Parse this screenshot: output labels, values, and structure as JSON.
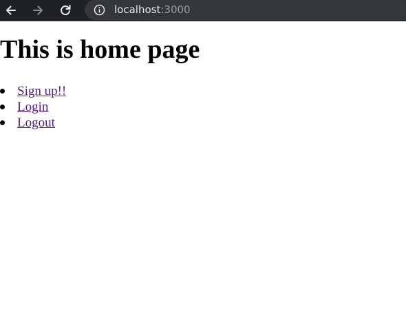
{
  "browser": {
    "address_bar": {
      "host": "localhost",
      "port": ":3000"
    },
    "icons": {
      "back": "back-arrow-icon",
      "forward": "forward-arrow-icon",
      "reload": "reload-icon",
      "site_info": "info-icon"
    },
    "colors": {
      "toolbar_bg": "#202124",
      "omnibox_bg": "#35363a",
      "link_visited": "#551a8b"
    }
  },
  "page": {
    "heading": "This is home page",
    "links": [
      {
        "label": "Sign up!!"
      },
      {
        "label": "Login"
      },
      {
        "label": "Logout"
      }
    ]
  }
}
